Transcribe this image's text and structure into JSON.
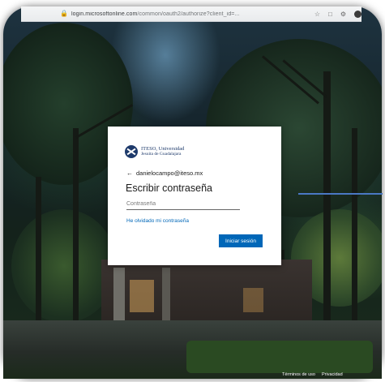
{
  "browser": {
    "url_host": "login.microsoftonline.com",
    "url_rest": "/common/oauth2/authorize?client_id=...",
    "lock_icon": "lock-icon"
  },
  "login": {
    "org_name_line1": "ITESO, Universidad",
    "org_name_line2": "Jesuita de Guadalajara",
    "back_icon": "arrow-left-icon",
    "account_email": "danielocampo@iteso.mx",
    "heading": "Escribir contraseña",
    "password_value": "",
    "password_placeholder": "Contraseña",
    "forgot_link": "He olvidado mi contraseña",
    "signin_label": "Iniciar sesión",
    "brand_color": "#0067b8"
  },
  "footer": {
    "terms": "Términos de uso",
    "privacy": "Privacidad"
  }
}
